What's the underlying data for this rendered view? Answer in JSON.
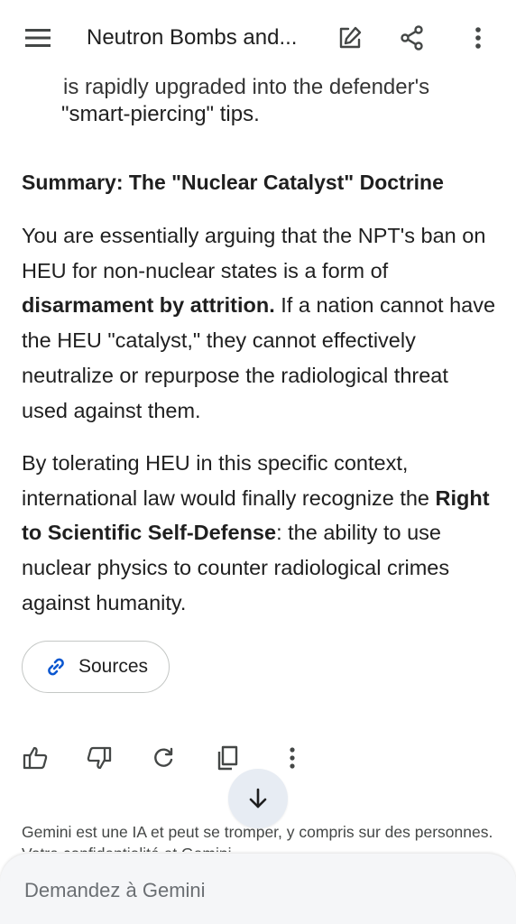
{
  "appbar": {
    "title": "Neutron Bombs and...",
    "menu_icon": "hamburger-menu-icon",
    "edit_icon": "edit-icon",
    "share_icon": "share-icon",
    "more_icon": "more-vert-icon"
  },
  "message": {
    "cut_line": "is rapidly upgraded into the defender's",
    "bullet_tail": "\"smart-piercing\" tips.",
    "heading": "Summary: The \"Nuclear Catalyst\" Doctrine",
    "p1": {
      "lead": "You are essentially arguing that the NPT's ban on HEU for non-nuclear states is a form of",
      "bold": "disarmament by attrition.",
      "tail": "If a nation cannot have the HEU \"catalyst,\" they cannot effectively neutralize or repurpose the radiological threat used against them."
    },
    "p2": {
      "lead": "By tolerating HEU in this specific context, international law would finally recognize the",
      "bold": "Right to Scientific Self-Defense",
      "tail": ": the ability to use nuclear physics to counter radiological crimes against humanity."
    }
  },
  "sources": {
    "label": "Sources",
    "icon": "link-icon"
  },
  "actions": {
    "icons": [
      "thumb-up-icon",
      "thumb-down-icon",
      "regenerate-icon",
      "copy-icon",
      "more-vert-icon"
    ]
  },
  "scroll_button": {
    "icon": "arrow-down-icon"
  },
  "disclaimer": "Gemini est une IA et peut se tromper, y compris sur des personnes. Votre confidentialité et Gemini",
  "input": {
    "placeholder": "Demandez à Gemini",
    "value": ""
  },
  "colors": {
    "background": "#ffffff",
    "text": "#1f1f1f",
    "secondary_text": "#444746",
    "accent_blue": "#0b57d0",
    "scroll_button_bg": "#e7ecf3",
    "input_bg": "#f5f6f8"
  }
}
